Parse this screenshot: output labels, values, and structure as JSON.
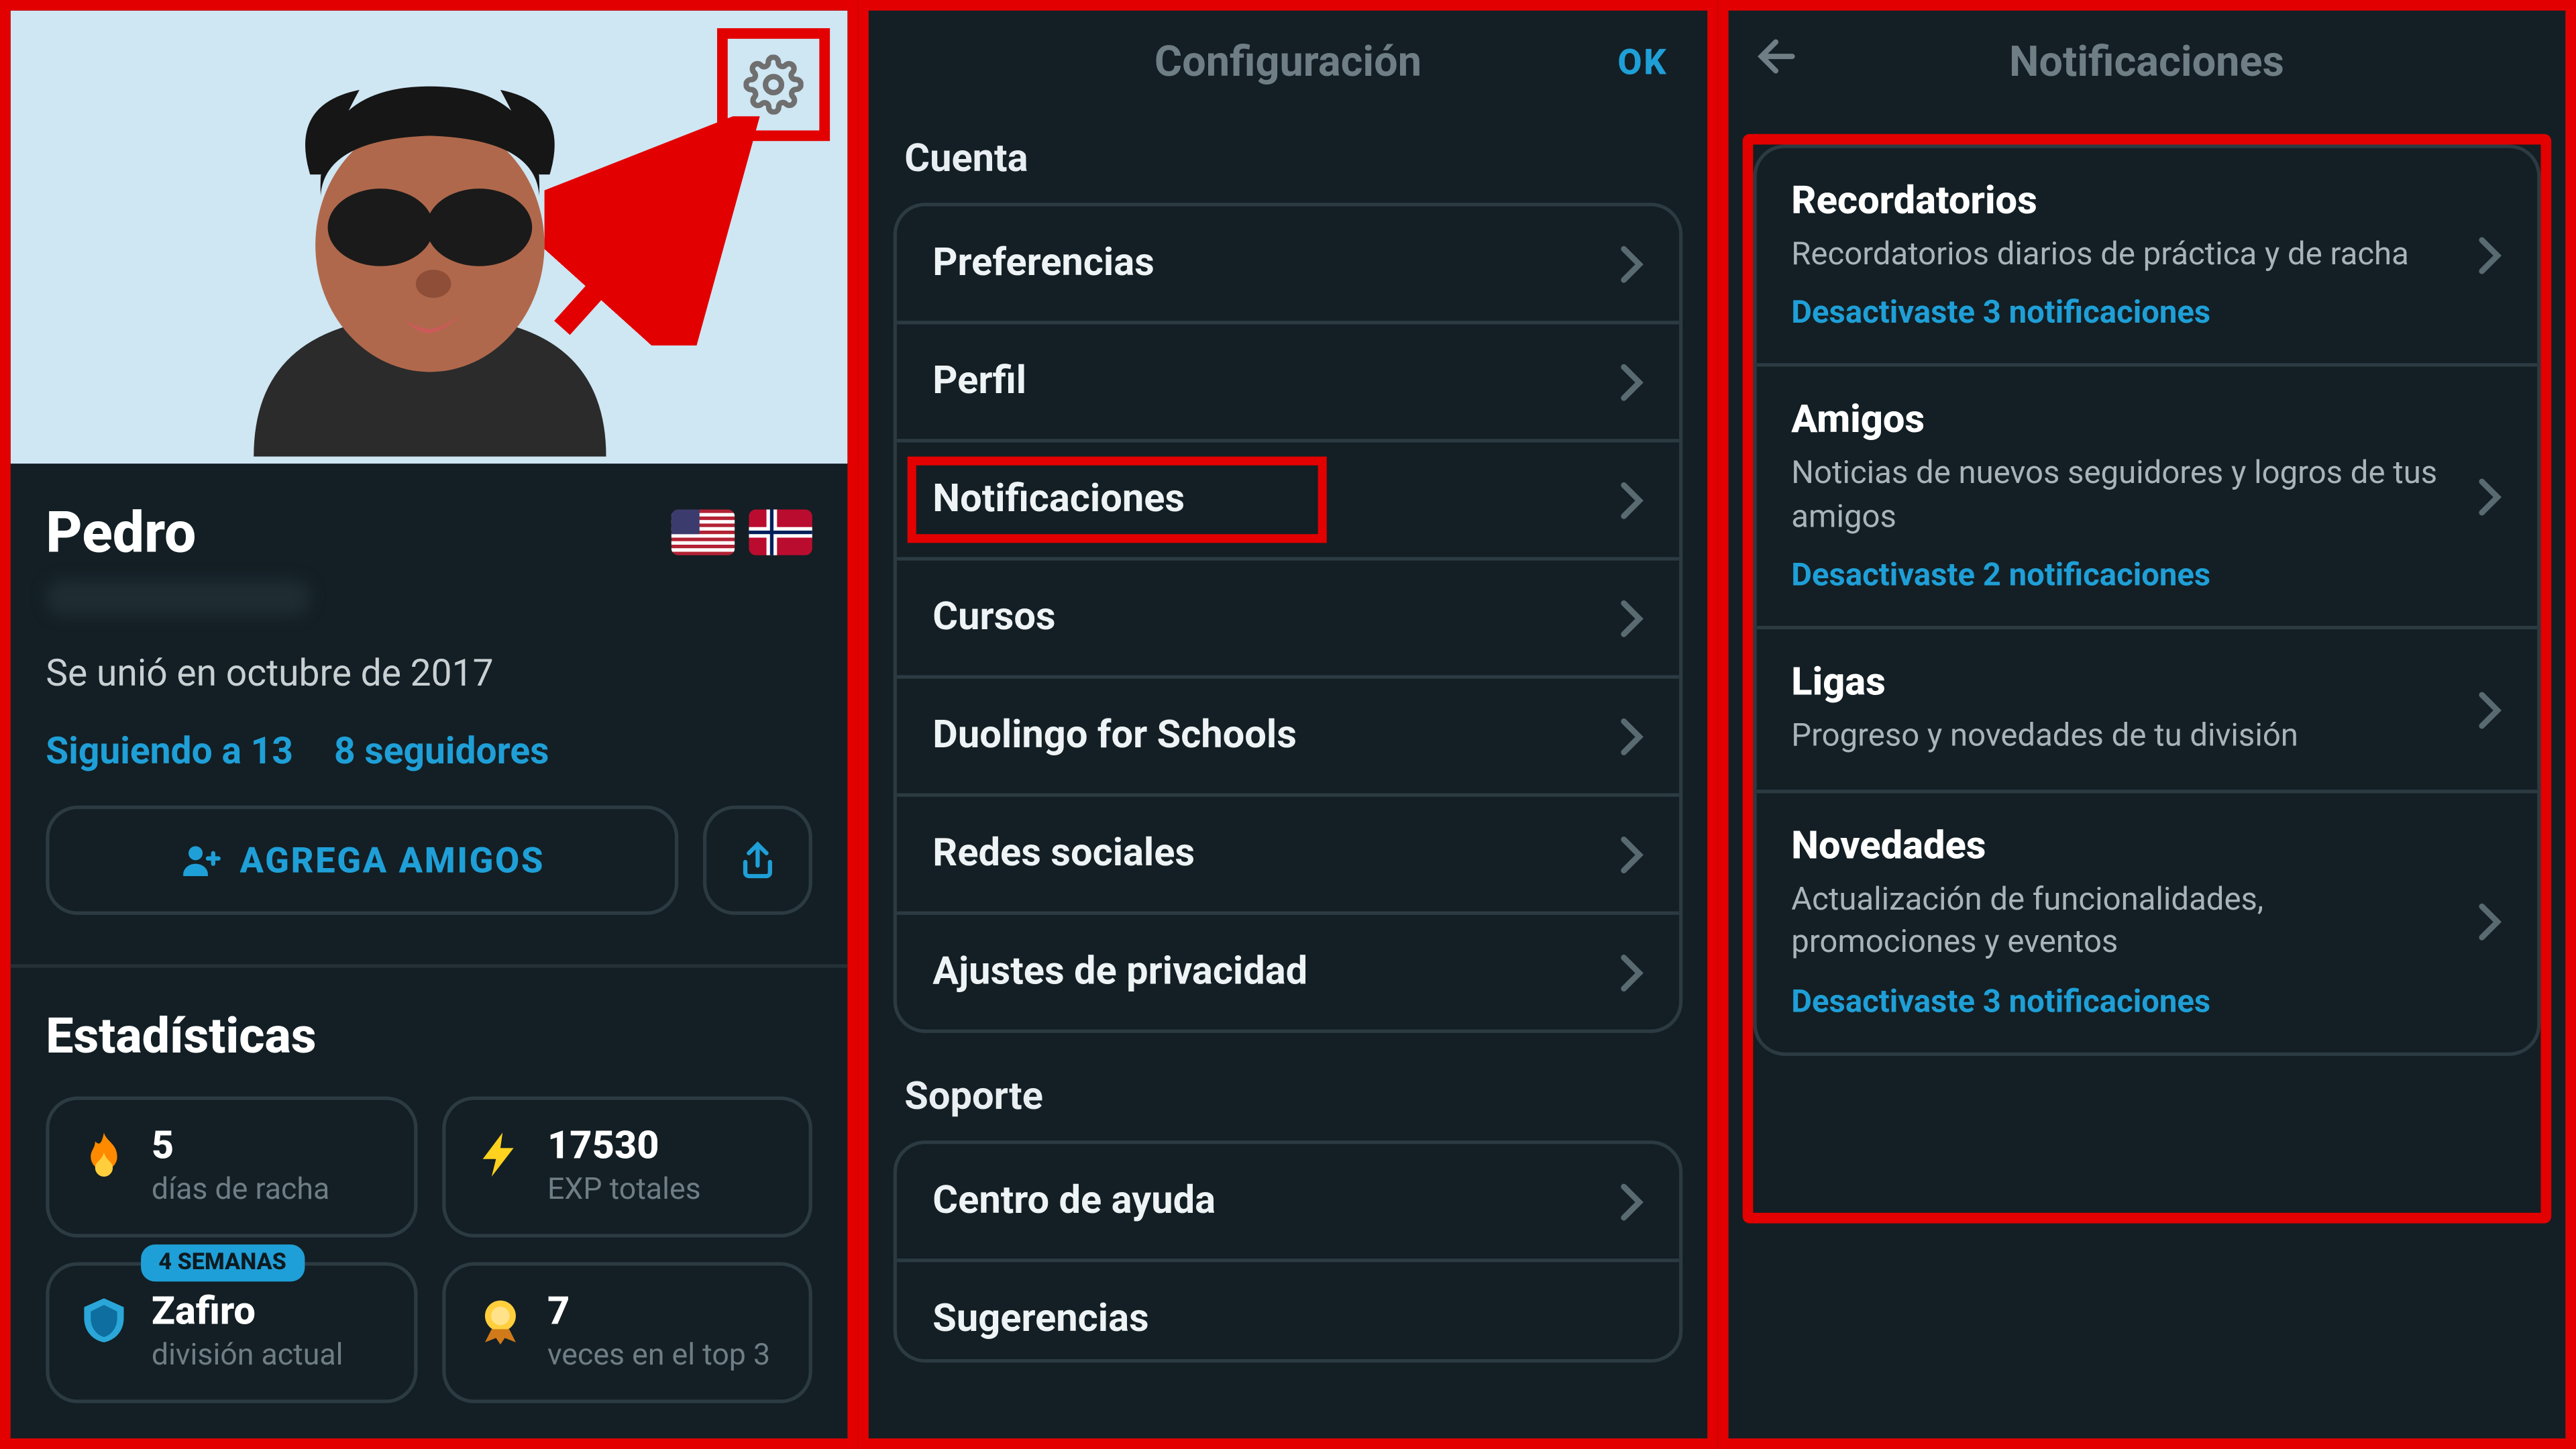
{
  "panel1": {
    "user_name": "Pedro",
    "joined": "Se unió en octubre de 2017",
    "following": "Siguiendo a 13",
    "followers": "8 seguidores",
    "add_friends": "AGREGA AMIGOS",
    "stats_title": "Estadísticas",
    "stats": {
      "streak": {
        "value": "5",
        "label": "días de racha"
      },
      "xp": {
        "value": "17530",
        "label": "EXP totales"
      },
      "league": {
        "value": "Zafiro",
        "label": "división actual",
        "badge": "4 SEMANAS"
      },
      "top3": {
        "value": "7",
        "label": "veces en el top 3"
      }
    },
    "flags": [
      "us",
      "no"
    ]
  },
  "panel2": {
    "title": "Configuración",
    "ok": "OK",
    "sections": {
      "account": {
        "label": "Cuenta",
        "items": [
          "Preferencias",
          "Perfil",
          "Notificaciones",
          "Cursos",
          "Duolingo for Schools",
          "Redes sociales",
          "Ajustes de privacidad"
        ]
      },
      "support": {
        "label": "Soporte",
        "items": [
          "Centro de ayuda",
          "Sugerencias"
        ]
      }
    }
  },
  "panel3": {
    "title": "Notificaciones",
    "items": [
      {
        "title": "Recordatorios",
        "desc": "Recordatorios diarios de práctica y de racha",
        "status": "Desactivaste 3 notificaciones"
      },
      {
        "title": "Amigos",
        "desc": "Noticias de nuevos seguidores y logros de tus amigos",
        "status": "Desactivaste 2 notificaciones"
      },
      {
        "title": "Ligas",
        "desc": "Progreso y novedades de tu división",
        "status": ""
      },
      {
        "title": "Novedades",
        "desc": "Actualización de funcionalidades, promociones y eventos",
        "status": "Desactivaste 3 notificaciones"
      }
    ]
  }
}
